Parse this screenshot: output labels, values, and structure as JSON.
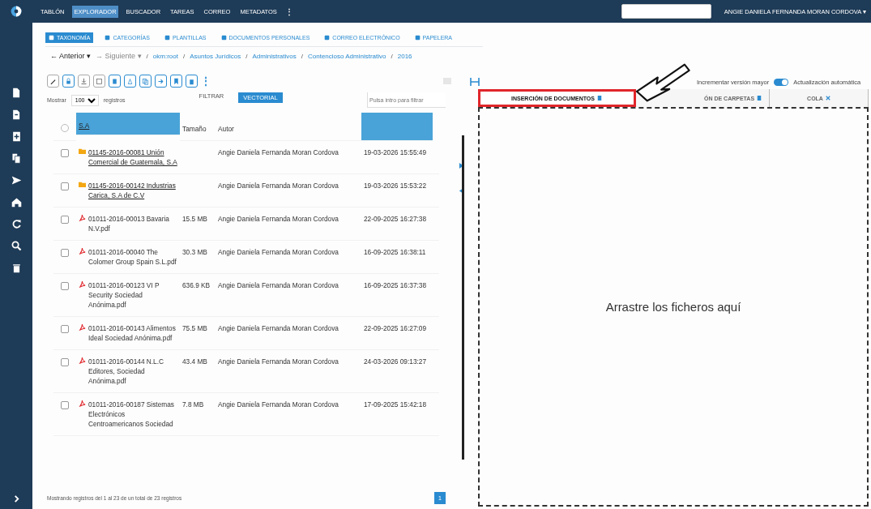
{
  "top_nav": {
    "items": [
      {
        "label": "TABLÓN",
        "selected": false
      },
      {
        "label": "EXPLORADOR",
        "selected": true
      },
      {
        "label": "BUSCADOR",
        "selected": false
      },
      {
        "label": "TAREAS",
        "selected": false
      },
      {
        "label": "CORREO",
        "selected": false
      },
      {
        "label": "METADATOS",
        "selected": false
      }
    ],
    "more": "⋮",
    "user": "ANGIE DANIELA FERNANDA MORAN CORDOVA ▾"
  },
  "sections": [
    {
      "label": "TAXONOMÍA",
      "selected": true
    },
    {
      "label": "CATEGORÍAS",
      "selected": false
    },
    {
      "label": "PLANTILLAS",
      "selected": false
    },
    {
      "label": "DOCUMENTOS PERSONALES",
      "selected": false
    },
    {
      "label": "CORREO ELECTRÓNICO",
      "selected": false
    },
    {
      "label": "PAPELERA",
      "selected": false
    }
  ],
  "navigation": {
    "back": "← Anterior ▾",
    "forward": "→ Siguiente ▾",
    "separator": "/",
    "breadcrumb": [
      "okm:root",
      "Asuntos Jurídicos",
      "Administrativos",
      "Contencioso Administrativo",
      "2016"
    ]
  },
  "toolbar": {
    "more": "⋮"
  },
  "list": {
    "show_label": "Mostrar",
    "page_size": "100",
    "records_label": "registros",
    "filter_label": "FILTRAR",
    "vector_button": "VECTORIAL",
    "filter_placeholder": "Pulsa intro para filtrar",
    "all_selected": false,
    "columns": [
      "S.A",
      "Tamaño",
      "Autor"
    ],
    "rows": [
      {
        "kind": "folder",
        "checked": false,
        "name": "01145-2016-00081 Unión Comercial de Guatemala, S.A",
        "size": "",
        "author": "Angie Daniela Fernanda Moran Cordova",
        "date": "19-03-2026 15:55:49"
      },
      {
        "kind": "folder",
        "checked": false,
        "name": "01145-2016-00142 Industrias Carica, S.A de C.V",
        "size": "",
        "author": "Angie Daniela Fernanda Moran Cordova",
        "date": "19-03-2026 15:53:22"
      },
      {
        "kind": "pdf",
        "checked": false,
        "name": "01011-2016-00013 Bavaria N.V.pdf",
        "size": "15.5 MB",
        "author": "Angie Daniela Fernanda Moran Cordova",
        "date": "22-09-2025 16:27:38"
      },
      {
        "kind": "pdf",
        "checked": false,
        "name": "01011-2016-00040 The Colomer Group Spain S.L.pdf",
        "size": "30.3 MB",
        "author": "Angie Daniela Fernanda Moran Cordova",
        "date": "16-09-2025 16:38:11"
      },
      {
        "kind": "pdf",
        "checked": false,
        "name": "01011-2016-00123 VI P Security Sociedad Anónima.pdf",
        "size": "636.9 KB",
        "author": "Angie Daniela Fernanda Moran Cordova",
        "date": "16-09-2025 16:37:38"
      },
      {
        "kind": "pdf",
        "checked": false,
        "name": "01011-2016-00143 Alimentos Ideal Sociedad Anónima.pdf",
        "size": "75.5 MB",
        "author": "Angie Daniela Fernanda Moran Cordova",
        "date": "22-09-2025 16:27:09"
      },
      {
        "kind": "pdf",
        "checked": false,
        "name": "01011-2016-00144 N.L.C Editores, Sociedad Anónima.pdf",
        "size": "43.4 MB",
        "author": "Angie Daniela Fernanda Moran Cordova",
        "date": "24-03-2026 09:13:27"
      },
      {
        "kind": "pdf",
        "checked": false,
        "name": "01011-2016-00187 Sistemas Electrónicos Centroamericanos Sociedad",
        "size": "7.8 MB",
        "author": "Angie Daniela Fernanda Moran Cordova",
        "date": "17-09-2025 15:42:18"
      }
    ],
    "footer": "Mostrando registros del 1 al 23 de un total de 23 registros",
    "page": "1"
  },
  "upload": {
    "major_version": {
      "label": "Incrementar versión mayor"
    },
    "auto_update": {
      "label": "Actualización automática",
      "on": true
    },
    "tabs": [
      {
        "label": "INSERCIÓN DE DOCUMENTOS",
        "selected": true,
        "highlighted": true
      },
      {
        "label": "ÓN DE CARPETAS",
        "selected": false,
        "highlighted": false
      },
      {
        "label": "COLA",
        "selected": false,
        "highlighted": false
      }
    ],
    "drop_text": "Arrastre los ficheros aquí"
  }
}
